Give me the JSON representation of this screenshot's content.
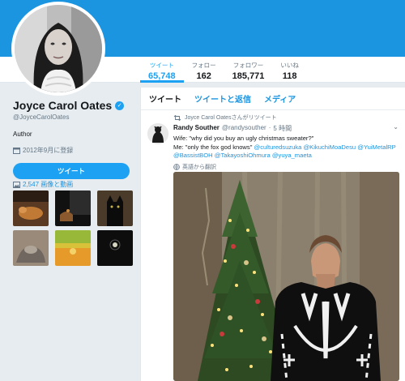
{
  "profile": {
    "name": "Joyce Carol Oates",
    "handle": "@JoyceCarolOates",
    "bio": "Author",
    "joined": "2012年9月に登録",
    "tweet_button": "ツイート",
    "media_link": "2,547 画像と動画"
  },
  "stats": [
    {
      "label": "ツイート",
      "value": "65,748"
    },
    {
      "label": "フォロー",
      "value": "162"
    },
    {
      "label": "フォロワー",
      "value": "185,771"
    },
    {
      "label": "いいね",
      "value": "118"
    }
  ],
  "tabs": [
    "ツイート",
    "ツイートと返信",
    "メディア"
  ],
  "tweet": {
    "retweet_note": "Joyce Carol Oatesさんがリツイート",
    "author_name": "Randy Souther",
    "author_handle": "@randysouther",
    "separator": "·",
    "time": "5 時間",
    "line1": "Wife: \"why did you buy an ugly christmas sweater?\"",
    "line2_prefix": "Me: \"only the fox god knows\"",
    "mentions_line2": [
      "@culturedsuzuka",
      "@KikuchiMoaDesu",
      "@YuiMetalRP"
    ],
    "mentions_line3": [
      "@BassistBOH",
      "@TakayoshiOhmura",
      "@yuya_maeta"
    ],
    "translate": "英語から翻訳"
  },
  "colors": {
    "banner": "#1b95e0",
    "accent": "#1da1f2",
    "link": "#1b95e0",
    "background": "#e6ecf0"
  }
}
